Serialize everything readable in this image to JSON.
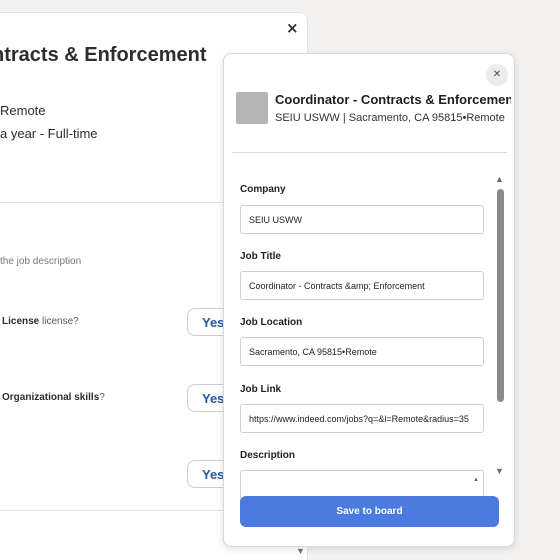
{
  "background_page": {
    "close_symbol": "×",
    "job_title": "ntracts & Enforcement",
    "location": "Remote",
    "salary": "a year  - Full-time",
    "hint": "the job description",
    "questions": [
      {
        "bold": "License",
        "rest": " license?"
      },
      {
        "bold": "Organizational skills",
        "rest": "?"
      }
    ],
    "yes_label": "Yes",
    "scroll_down_symbol": "▼"
  },
  "panel": {
    "close_symbol": "✕",
    "header": {
      "title": "Coordinator - Contracts & Enforcement",
      "subtitle": "SEIU USWW | Sacramento, CA 95815•Remote"
    },
    "fields": {
      "company": {
        "label": "Company",
        "value": "SEIU USWW"
      },
      "job_title": {
        "label": "Job Title",
        "value": "Coordinator - Contracts &amp; Enforcement"
      },
      "job_location": {
        "label": "Job Location",
        "value": "Sacramento, CA 95815•Remote"
      },
      "job_link": {
        "label": "Job Link",
        "value": "https://www.indeed.com/jobs?q=&l=Remote&radius=35"
      },
      "description": {
        "label": "Description",
        "value": ""
      }
    },
    "scroll_up_symbol": "▲",
    "scroll_down_symbol": "▼",
    "textarea_arrow": "▲",
    "save_label": "Save to board"
  }
}
